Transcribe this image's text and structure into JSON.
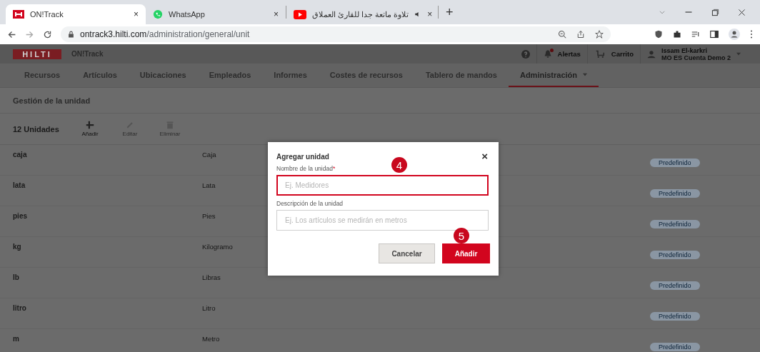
{
  "browser": {
    "tabs": [
      {
        "title": "ON!Track",
        "close": "×",
        "selected": true
      },
      {
        "title": "WhatsApp",
        "close": "×",
        "selected": false
      },
      {
        "title": "تلاوة ماتعة جدا للقارئ العملاق",
        "close": "×",
        "selected": false,
        "audio": true
      }
    ],
    "new_tab": "+",
    "url_host": "ontrack3.hilti.com",
    "url_path": "/administration/general/unit"
  },
  "app": {
    "logo": "HILTI",
    "name": "ON!Track",
    "alerts": "Alertas",
    "alerts_unread": true,
    "cart": "Carrito",
    "user_name": "Issam El-karkri",
    "account": "MO ES Cuenta Demo 2"
  },
  "nav": [
    {
      "label": "Recursos",
      "selected": false
    },
    {
      "label": "Artículos",
      "selected": false
    },
    {
      "label": "Ubicaciones",
      "selected": false
    },
    {
      "label": "Empleados",
      "selected": false
    },
    {
      "label": "Informes",
      "selected": false
    },
    {
      "label": "Costes de recursos",
      "selected": false
    },
    {
      "label": "Tablero de mandos",
      "selected": false
    },
    {
      "label": "Administración",
      "selected": true,
      "dropdown": true
    }
  ],
  "page_title": "Gestión de la unidad",
  "toolbar": {
    "count": "12 Unidades",
    "actions": [
      {
        "kind": "add",
        "label": "Añadir",
        "disabled": false
      },
      {
        "kind": "edit",
        "label": "Editar",
        "disabled": true
      },
      {
        "kind": "delete",
        "label": "Eliminar",
        "disabled": true
      }
    ]
  },
  "rows": [
    {
      "name": "caja",
      "description": "Caja",
      "badge": "Predefinido"
    },
    {
      "name": "lata",
      "description": "Lata",
      "badge": "Predefinido"
    },
    {
      "name": "pies",
      "description": "Pies",
      "badge": "Predefinido"
    },
    {
      "name": "kg",
      "description": "Kilogramo",
      "badge": "Predefinido"
    },
    {
      "name": "lb",
      "description": "Libras",
      "badge": "Predefinido"
    },
    {
      "name": "litro",
      "description": "Litro",
      "badge": "Predefinido"
    },
    {
      "name": "m",
      "description": "Metro",
      "badge": "Predefinido"
    }
  ],
  "dialog": {
    "title": "Agregar unidad",
    "close": "×",
    "required_mark": "*",
    "fields": [
      {
        "label": "Nombre de la unidad",
        "required": true,
        "placeholder": "Ej. Medidores",
        "highlighted": true,
        "step": "4"
      },
      {
        "label": "Descripción de la unidad",
        "required": false,
        "placeholder": "Ej. Los artículos se medirán en metros",
        "highlighted": false
      }
    ],
    "cancel": "Cancelar",
    "submit": "Añadir",
    "submit_step": "5"
  }
}
